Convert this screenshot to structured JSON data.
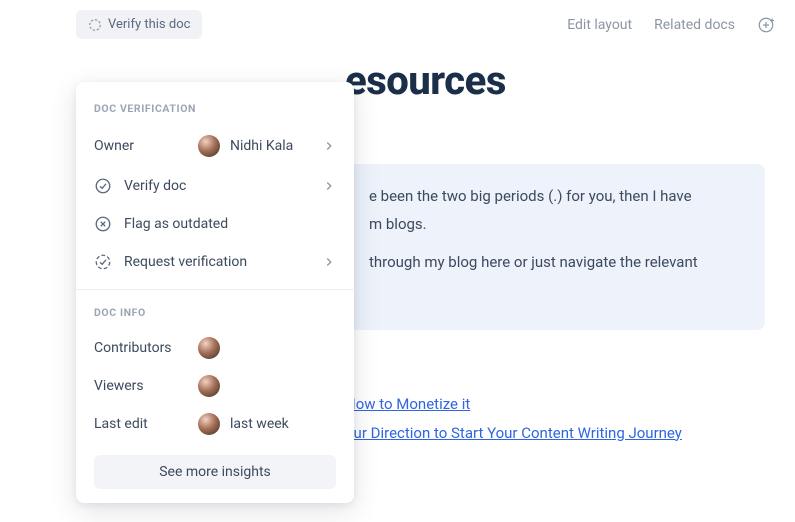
{
  "topbar": {
    "verify_button": "Verify this doc",
    "edit_layout": "Edit layout",
    "related_docs": "Related docs"
  },
  "page": {
    "title_fragment": "esources"
  },
  "infobox": {
    "line1": "e been the two big periods (.) for you, then I have",
    "line2": "m blogs.",
    "line3": "through my blog here or just navigate the relevant"
  },
  "links": {
    "item1": "How to Monetize it",
    "item2": "our Direction to Start Your Content Writing Journey"
  },
  "popover": {
    "verification_title": "DOC VERIFICATION",
    "owner_label": "Owner",
    "owner_name": "Nidhi Kala",
    "verify_doc": "Verify doc",
    "flag_outdated": "Flag as outdated",
    "request_verification": "Request verification",
    "info_title": "DOC INFO",
    "contributors_label": "Contributors",
    "viewers_label": "Viewers",
    "last_edit_label": "Last edit",
    "last_edit_value": "last week",
    "insights_button": "See more insights"
  }
}
